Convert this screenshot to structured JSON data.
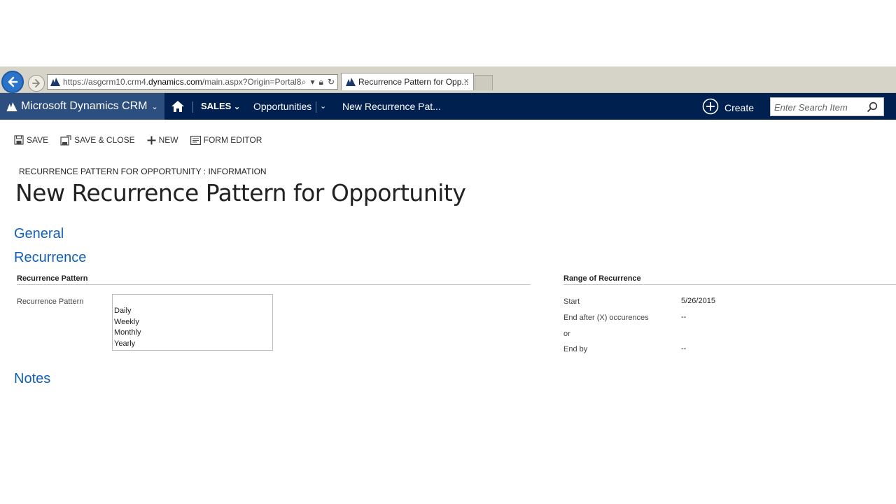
{
  "browser": {
    "url_prefix": "https://asgcrm10.crm4.",
    "url_domain": "dynamics.com",
    "url_suffix": "/main.aspx?Origin=Portal8",
    "tab_title": "Recurrence Pattern for Opp...",
    "tab_close": "×"
  },
  "nav": {
    "brand": "Microsoft Dynamics CRM",
    "area": "SALES",
    "entity": "Opportunities",
    "current": "New Recurrence Pat...",
    "create_label": "Create",
    "search_placeholder": "Enter Search Item"
  },
  "commands": {
    "save": "SAVE",
    "save_close": "SAVE & CLOSE",
    "new": "NEW",
    "form_editor": "FORM EDITOR"
  },
  "header": {
    "entity_form": "RECURRENCE PATTERN FOR OPPORTUNITY : INFORMATION",
    "title": "New Recurrence Pattern for Opportunity"
  },
  "sections": {
    "general": "General",
    "recurrence": "Recurrence",
    "notes": "Notes"
  },
  "recurrence_pattern": {
    "heading": "Recurrence Pattern",
    "field_label": "Recurrence Pattern",
    "options": [
      "Daily",
      "Weekly",
      "Monthly",
      "Yearly"
    ]
  },
  "range": {
    "heading": "Range of Recurrence",
    "start_label": "Start",
    "start_value": "5/26/2015",
    "end_after_label": "End after (X) occurences",
    "end_after_value": "--",
    "or_label": "or",
    "end_by_label": "End by",
    "end_by_value": "--"
  },
  "colors": {
    "nav_bg": "#002050",
    "brand_bg": "#2d4f80",
    "section_heading": "#1160b7",
    "browser_chrome": "#d6d3c9"
  }
}
